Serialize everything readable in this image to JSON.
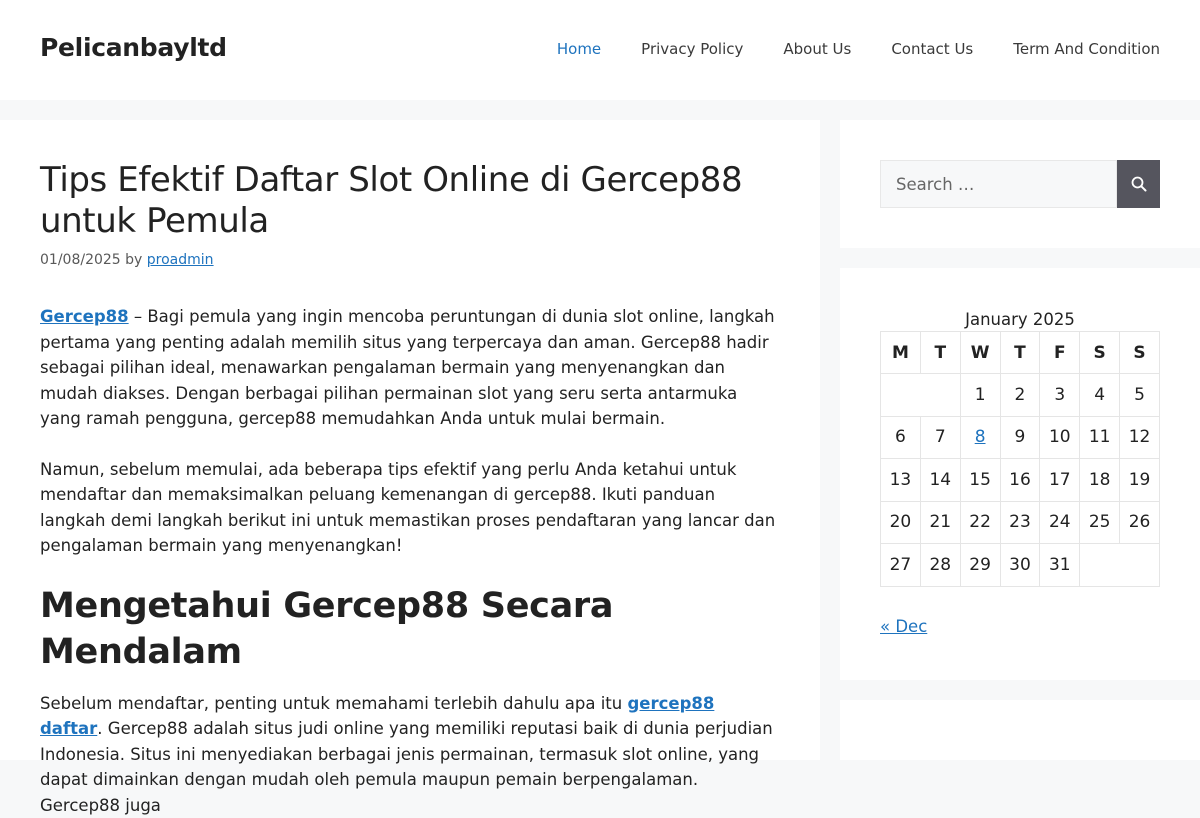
{
  "site": {
    "title": "Pelicanbayltd"
  },
  "nav": {
    "items": [
      "Home",
      "Privacy Policy",
      "About Us",
      "Contact Us",
      "Term And Condition"
    ]
  },
  "post": {
    "title": "Tips Efektif Daftar Slot Online di Gercep88 untuk Pemula",
    "date": "01/08/2025",
    "by": "by",
    "author": "proadmin",
    "p1_link": "Gercep88",
    "p1_text": " – Bagi pemula yang ingin mencoba peruntungan di dunia slot online, langkah pertama yang penting adalah memilih situs yang terpercaya dan aman. Gercep88 hadir sebagai pilihan ideal, menawarkan pengalaman bermain yang menyenangkan dan mudah diakses. Dengan berbagai pilihan permainan slot yang seru serta antarmuka yang ramah pengguna, gercep88 memudahkan Anda untuk mulai bermain.",
    "p2": "Namun, sebelum memulai, ada beberapa tips efektif yang perlu Anda ketahui untuk mendaftar dan memaksimalkan peluang kemenangan di gercep88. Ikuti panduan langkah demi langkah berikut ini untuk memastikan proses pendaftaran yang lancar dan pengalaman bermain yang menyenangkan!",
    "h2": "Mengetahui Gercep88 Secara Mendalam",
    "p3_start": "Sebelum mendaftar, penting untuk memahami terlebih dahulu apa itu ",
    "p3_link": "gercep88 daftar",
    "p3_rest": ". Gercep88 adalah situs judi online yang memiliki reputasi baik di dunia perjudian Indonesia. Situs ini menyediakan berbagai jenis permainan, termasuk slot online, yang dapat dimainkan dengan mudah oleh pemula maupun pemain berpengalaman. Gercep88 juga"
  },
  "search": {
    "placeholder": "Search …"
  },
  "calendar": {
    "caption": "January 2025",
    "days": [
      "M",
      "T",
      "W",
      "T",
      "F",
      "S",
      "S"
    ],
    "weeks": [
      [
        "",
        "",
        "1",
        "2",
        "3",
        "4",
        "5"
      ],
      [
        "6",
        "7",
        "8",
        "9",
        "10",
        "11",
        "12"
      ],
      [
        "13",
        "14",
        "15",
        "16",
        "17",
        "18",
        "19"
      ],
      [
        "20",
        "21",
        "22",
        "23",
        "24",
        "25",
        "26"
      ],
      [
        "27",
        "28",
        "29",
        "30",
        "31",
        "",
        ""
      ]
    ],
    "linked_day": "8",
    "prev": "« Dec"
  },
  "colors": {
    "accent": "#1e73be",
    "search_button": "#55555e",
    "background": "#f7f8f9"
  },
  "icons": {
    "search_button": "search-icon"
  }
}
